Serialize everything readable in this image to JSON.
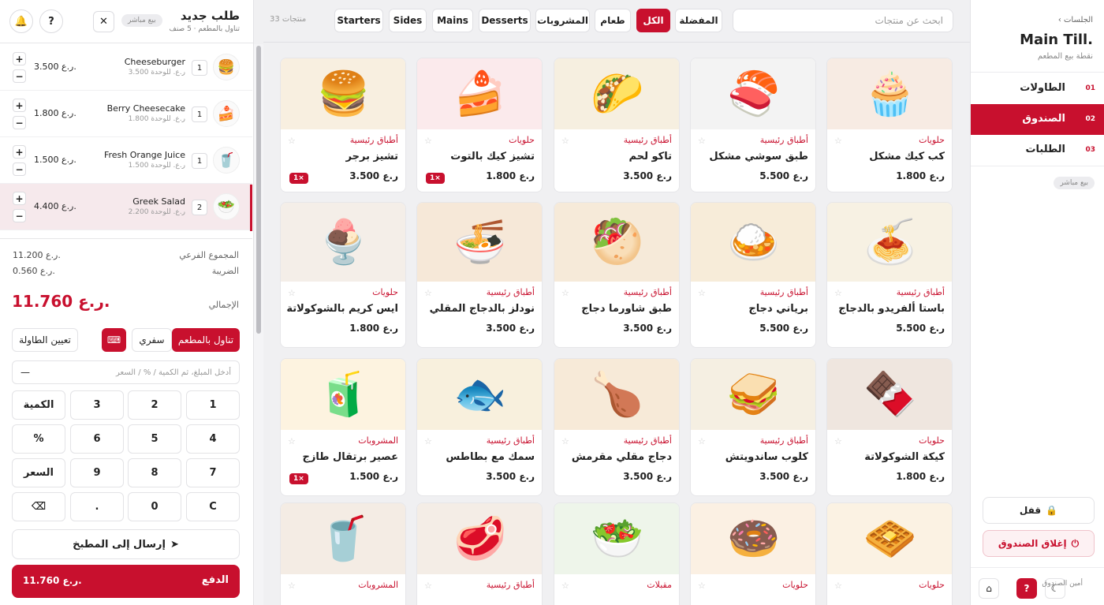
{
  "order": {
    "title": "طلب جديد",
    "subtitle": "تناول بالمطعم · 5 صنف",
    "mode_badge": "بيع مباشر",
    "close_icon": "close-icon",
    "help_label": "?",
    "bell_icon": "bell-icon",
    "lines": [
      {
        "name": "Cheeseburger",
        "unit": "3.500 ر.ع. للوحدة",
        "qty": "1",
        "price": "3.500 ر.ع.",
        "icon": "🍔"
      },
      {
        "name": "Berry Cheesecake",
        "unit": "1.800 ر.ع. للوحدة",
        "qty": "1",
        "price": "1.800 ر.ع.",
        "icon": "🍰"
      },
      {
        "name": "Fresh Orange Juice",
        "unit": "1.500 ر.ع. للوحدة",
        "qty": "1",
        "price": "1.500 ر.ع.",
        "icon": "🥤"
      },
      {
        "name": "Greek Salad",
        "unit": "2.200 ر.ع. للوحدة",
        "qty": "2",
        "price": "4.400 ر.ع.",
        "icon": "🥗"
      }
    ],
    "subtotal_label": "المجموع الفرعي",
    "subtotal_value": "11.200 ر.ع.",
    "tax_label": "الضريبة",
    "tax_value": "0.560 ر.ع.",
    "total_label": "الإجمالي",
    "total_value": "11.760 ر.ع.",
    "dine_in": "تناول بالمطعم",
    "takeaway": "سفري",
    "keyboard_icon": "⌨",
    "assign_table": "تعيين الطاولة",
    "entry_placeholder": "أدخل المبلغ، ثم الكمية / % / السعر",
    "entry_value": "—",
    "keys": [
      "1",
      "2",
      "3",
      "الكمية",
      "4",
      "5",
      "6",
      "%",
      "7",
      "8",
      "9",
      "السعر",
      "C",
      "0",
      ".",
      "⌫"
    ],
    "send_kitchen": "إرسال إلى المطبخ",
    "pay_label": "الدفع",
    "pay_value": "11.760 ر.ع."
  },
  "catalog": {
    "count": "33 منتجات",
    "search_placeholder": "ابحث عن منتجات",
    "chips": [
      "المفضلة",
      "الكل",
      "طعام",
      "المشروبات",
      "Desserts",
      "Mains",
      "Sides",
      "Starters"
    ],
    "active_chip": "الكل",
    "products": [
      {
        "name": "كب كيك مشكل",
        "cat": "حلويات",
        "price": "1.800 ر.ع",
        "icon": "🧁",
        "bg": "#f7ebe3",
        "incart": ""
      },
      {
        "name": "طبق سوشي مشكل",
        "cat": "أطباق رئيسية",
        "price": "5.500 ر.ع",
        "icon": "🍣",
        "bg": "#f3f3f3",
        "incart": ""
      },
      {
        "name": "تاكو لحم",
        "cat": "أطباق رئيسية",
        "price": "3.500 ر.ع",
        "icon": "🌮",
        "bg": "#f6efe0",
        "incart": ""
      },
      {
        "name": "تشيز كيك بالتوت",
        "cat": "حلويات",
        "price": "1.800 ر.ع",
        "icon": "🍰",
        "bg": "#fbeaec",
        "incart": "1×"
      },
      {
        "name": "تشيز برجر",
        "cat": "أطباق رئيسية",
        "price": "3.500 ر.ع",
        "icon": "🍔",
        "bg": "#f8efe0",
        "incart": "1×"
      },
      {
        "name": "باستا ألفريدو بالدجاج",
        "cat": "أطباق رئيسية",
        "price": "5.500 ر.ع",
        "icon": "🍝",
        "bg": "#f7f1e3",
        "incart": ""
      },
      {
        "name": "برياني دجاج",
        "cat": "أطباق رئيسية",
        "price": "5.500 ر.ع",
        "icon": "🍛",
        "bg": "#f7ecd9",
        "incart": ""
      },
      {
        "name": "طبق شاورما دجاج",
        "cat": "أطباق رئيسية",
        "price": "3.500 ر.ع",
        "icon": "🥙",
        "bg": "#f6ead9",
        "incart": ""
      },
      {
        "name": "نودلز بالدجاج المقلي",
        "cat": "أطباق رئيسية",
        "price": "3.500 ر.ع",
        "icon": "🍜",
        "bg": "#f6e8d8",
        "incart": ""
      },
      {
        "name": "ايس كريم بالشوكولاتة",
        "cat": "حلويات",
        "price": "1.800 ر.ع",
        "icon": "🍨",
        "bg": "#f4eee8",
        "incart": ""
      },
      {
        "name": "كيكة الشوكولاتة",
        "cat": "حلويات",
        "price": "1.800 ر.ع",
        "icon": "🍫",
        "bg": "#efe6df",
        "incart": ""
      },
      {
        "name": "كلوب ساندويتش",
        "cat": "أطباق رئيسية",
        "price": "3.500 ر.ع",
        "icon": "🥪",
        "bg": "#f5efe2",
        "incart": ""
      },
      {
        "name": "دجاج مقلي مقرمش",
        "cat": "أطباق رئيسية",
        "price": "3.500 ر.ع",
        "icon": "🍗",
        "bg": "#f7ead8",
        "incart": ""
      },
      {
        "name": "سمك مع بطاطس",
        "cat": "أطباق رئيسية",
        "price": "3.500 ر.ع",
        "icon": "🐟",
        "bg": "#f8f0dd",
        "incart": ""
      },
      {
        "name": "عصير برتقال طازج",
        "cat": "المشروبات",
        "price": "1.500 ر.ع",
        "icon": "🧃",
        "bg": "#fdf3e0",
        "incart": "1×"
      },
      {
        "name": "",
        "cat": "حلويات",
        "price": "",
        "icon": "🧇",
        "bg": "#fbf2e3",
        "incart": ""
      },
      {
        "name": "",
        "cat": "حلويات",
        "price": "",
        "icon": "🍩",
        "bg": "#fbf0e3",
        "incart": ""
      },
      {
        "name": "",
        "cat": "مقبلات",
        "price": "",
        "icon": "🥗",
        "bg": "#eef5ea",
        "incart": ""
      },
      {
        "name": "",
        "cat": "أطباق رئيسية",
        "price": "",
        "icon": "🥩",
        "bg": "#f4ede6",
        "incart": ""
      },
      {
        "name": "",
        "cat": "المشروبات",
        "price": "",
        "icon": "🥤",
        "bg": "#f4ece4",
        "incart": ""
      }
    ]
  },
  "nav": {
    "back_label": "الجلسات",
    "till_name": "Main Till.",
    "till_sub": "نقطة بيع المطعم",
    "items": [
      {
        "num": "01",
        "label": "الطاولات"
      },
      {
        "num": "02",
        "label": "الصندوق"
      },
      {
        "num": "03",
        "label": "الطلبات"
      }
    ],
    "active": "الصندوق",
    "mode_pill": "بيع مباشر",
    "lock_label": "قفل",
    "close_till_label": "إغلاق الصندوق",
    "cashier_label": "أمين الصندوق",
    "help_label": "?"
  }
}
